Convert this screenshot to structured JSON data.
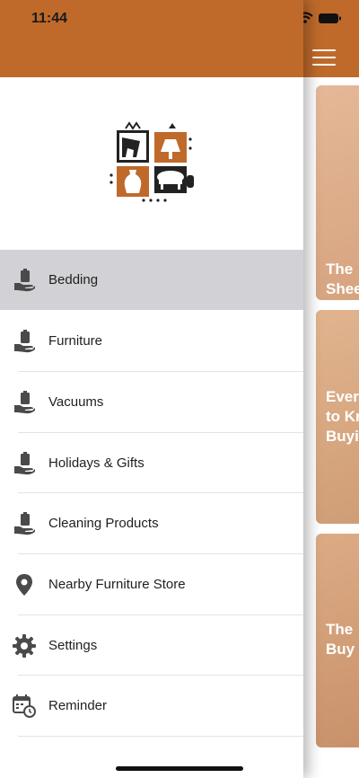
{
  "status_bar": {
    "time": "11:44"
  },
  "menu": {
    "items": [
      {
        "label": "Bedding",
        "icon": "hand-holding-bag-icon",
        "active": true
      },
      {
        "label": "Furniture",
        "icon": "hand-holding-bag-icon",
        "active": false
      },
      {
        "label": "Vacuums",
        "icon": "hand-holding-bag-icon",
        "active": false
      },
      {
        "label": "Holidays & Gifts",
        "icon": "hand-holding-bag-icon",
        "active": false
      },
      {
        "label": "Cleaning Products",
        "icon": "hand-holding-bag-icon",
        "active": false
      },
      {
        "label": "Nearby Furniture Store",
        "icon": "map-pin-icon",
        "active": false
      },
      {
        "label": "Settings",
        "icon": "gear-icon",
        "active": false
      },
      {
        "label": "Reminder",
        "icon": "calendar-clock-icon",
        "active": false
      }
    ]
  },
  "background_cards": [
    {
      "lines": [
        "The",
        "Shee"
      ]
    },
    {
      "lines": [
        "Ever",
        "to Kr",
        "Buyi"
      ]
    },
    {
      "lines": [
        "The",
        "Buy"
      ]
    }
  ],
  "colors": {
    "brand": "#bf6a2b",
    "active_row": "#d2d2d6",
    "text": "#1f1f1f",
    "icon": "#4a4a4a"
  }
}
